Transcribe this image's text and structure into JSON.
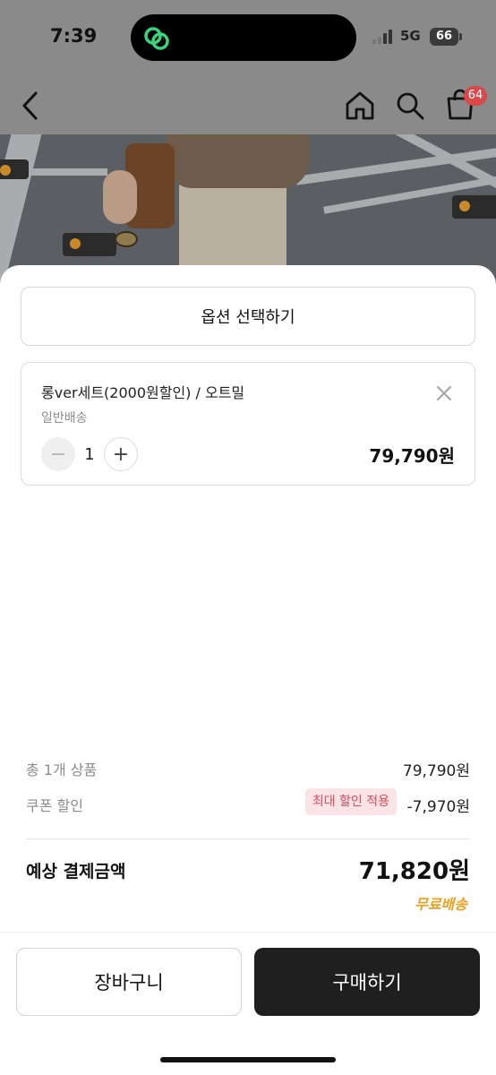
{
  "status_bar": {
    "time": "7:39",
    "network": "5G",
    "battery": "66"
  },
  "nav": {
    "back_icon": "chevron-left-icon",
    "home_icon": "home-icon",
    "search_icon": "search-icon",
    "cart_icon": "shopping-bag-icon",
    "cart_badge": "64"
  },
  "sheet": {
    "option_select_label": "옵션 선택하기",
    "item": {
      "name": "롱ver세트(2000원할인) / 오트밀",
      "shipping": "일반배송",
      "quantity": "1",
      "minus": "−",
      "plus": "+",
      "price": "79,790원"
    },
    "summary": {
      "total_items_label": "총 1개 상품",
      "total_items_value": "79,790원",
      "coupon_label": "쿠폰 할인",
      "coupon_badge": "최대 할인 적용",
      "coupon_value": "-7,970원",
      "expected_label": "예상 결제금액",
      "expected_value": "71,820원",
      "free_shipping": "무료배송"
    },
    "buttons": {
      "cart": "장바구니",
      "buy": "구매하기"
    }
  },
  "colors": {
    "badge": "#d9484a",
    "coupon_bg": "#fbe4e6",
    "coupon_text": "#d94c5b",
    "free_shipping": "#f0a020",
    "buy_button": "#1f1f1f"
  }
}
